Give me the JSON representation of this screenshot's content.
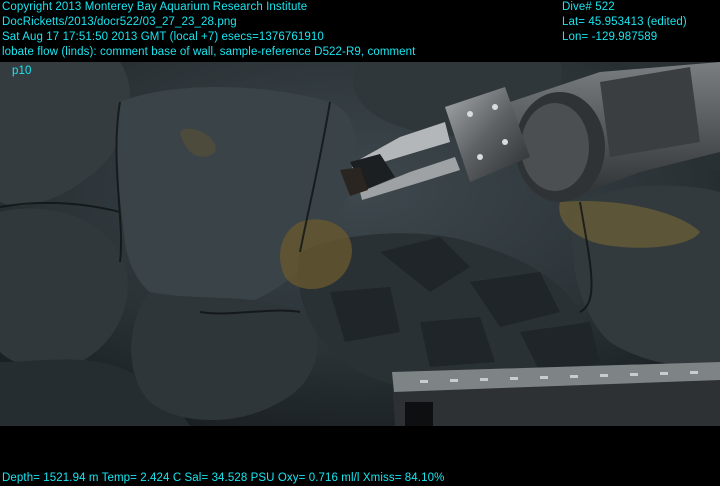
{
  "overlay": {
    "copyright": "Copyright 2013 Monterey Bay Aquarium Research Institute",
    "filename": "DocRicketts/2013/docr522/03_27_23_28.png",
    "datetime": "Sat Aug 17 17:51:50 2013 GMT (local +7)  esecs=1376761910",
    "annotation": "lobate flow (linds): comment base of wall, sample-reference D522-R9, comment",
    "tag": "p10",
    "dive": "Dive# 522",
    "lat": "Lat= 45.953413 (edited)",
    "lon": "Lon= -129.987589",
    "sensors": "Depth= 1521.94 m  Temp= 2.424 C  Sal= 34.528 PSU  Oxy= 0.716 ml/l  Xmiss= 84.10%"
  },
  "colors": {
    "overlay_text": "#18e6f0",
    "letterbox": "#000000",
    "seafloor": "#2b3338",
    "sediment": "#6b5a2e"
  }
}
